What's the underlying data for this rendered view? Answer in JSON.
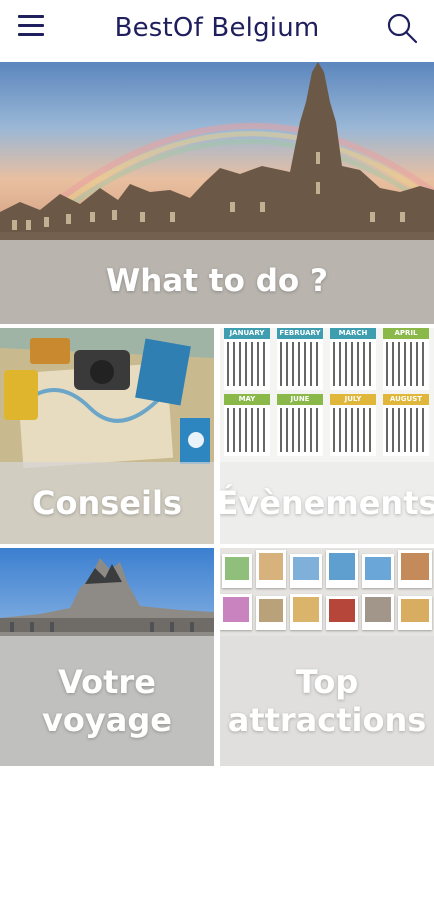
{
  "header": {
    "title": "BestOf Belgium",
    "menu_icon": "hamburger-menu-icon",
    "search_icon": "search-icon"
  },
  "tiles": [
    {
      "label": "What to do ?"
    },
    {
      "label": "Conseils"
    },
    {
      "label": "Évènements"
    },
    {
      "label": "Votre voyage"
    },
    {
      "label": "Top attractions"
    }
  ],
  "calendar": {
    "months": [
      "JANUARY",
      "FEBRUARY",
      "MARCH",
      "APRIL",
      "MAY",
      "JUNE",
      "JULY",
      "AUGUST"
    ]
  },
  "colors": {
    "brand": "#1f1f5e",
    "tile_overlay": "#d4d4d4",
    "label": "#ffffff",
    "calendar_q1": "#3f9db0",
    "calendar_q2": "#8ab94a",
    "calendar_q3": "#e0b73a"
  }
}
